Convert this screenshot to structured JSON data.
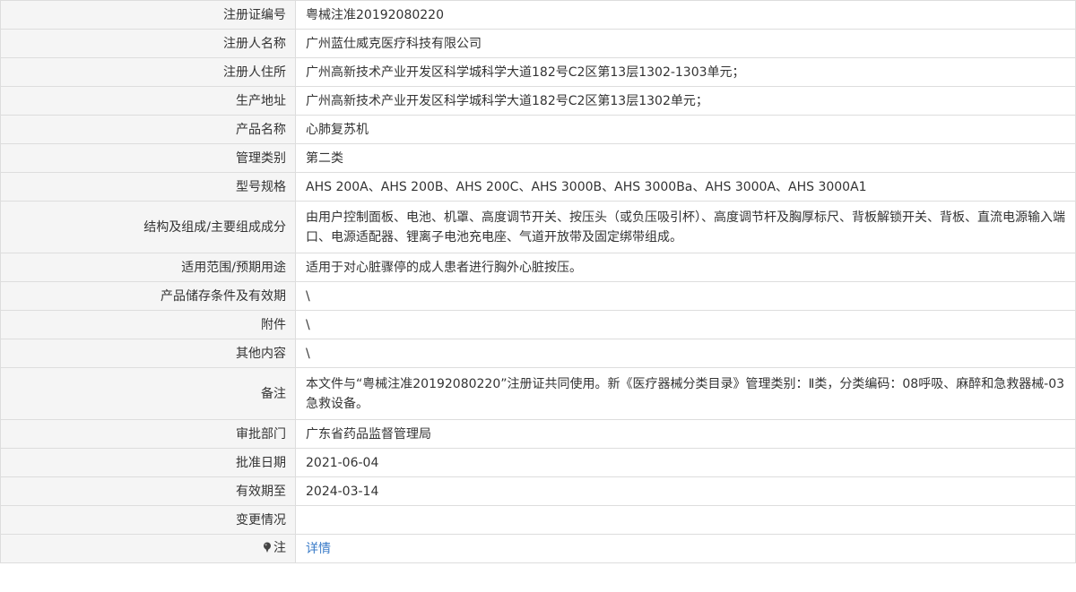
{
  "record": {
    "rows": [
      {
        "label": "注册证编号",
        "value": "粤械注准20192080220"
      },
      {
        "label": "注册人名称",
        "value": "广州蓝仕威克医疗科技有限公司"
      },
      {
        "label": "注册人住所",
        "value": "广州高新技术产业开发区科学城科学大道182号C2区第13层1302-1303单元；"
      },
      {
        "label": "生产地址",
        "value": "广州高新技术产业开发区科学城科学大道182号C2区第13层1302单元；"
      },
      {
        "label": "产品名称",
        "value": "心肺复苏机"
      },
      {
        "label": "管理类别",
        "value": "第二类"
      },
      {
        "label": "型号规格",
        "value": "AHS 200A、AHS 200B、AHS 200C、AHS 3000B、AHS 3000Ba、AHS 3000A、AHS 3000A1"
      },
      {
        "label": "结构及组成/主要组成成分",
        "value": "由用户控制面板、电池、机罩、高度调节开关、按压头（或负压吸引杯）、高度调节杆及胸厚标尺、背板解锁开关、背板、直流电源输入端口、电源适配器、锂离子电池充电座、气道开放带及固定绑带组成。"
      },
      {
        "label": "适用范围/预期用途",
        "value": "适用于对心脏骤停的成人患者进行胸外心脏按压。"
      },
      {
        "label": "产品储存条件及有效期",
        "value": "\\"
      },
      {
        "label": "附件",
        "value": "\\"
      },
      {
        "label": "其他内容",
        "value": "\\"
      },
      {
        "label": "备注",
        "value": "本文件与“粤械注准20192080220”注册证共同使用。新《医疗器械分类目录》管理类别：Ⅱ类，分类编码：08呼吸、麻醉和急救器械-03急救设备。"
      },
      {
        "label": "审批部门",
        "value": "广东省药品监督管理局"
      },
      {
        "label": "批准日期",
        "value": "2021-06-04"
      },
      {
        "label": "有效期至",
        "value": "2024-03-14"
      },
      {
        "label": "变更情况",
        "value": ""
      }
    ],
    "note_row": {
      "label": "注",
      "link_text": "详情",
      "icon": "pin-icon"
    }
  },
  "colors": {
    "label_bg": "#f5f5f5",
    "border": "#dddddd",
    "link": "#3a7bc8",
    "text": "#333333"
  }
}
